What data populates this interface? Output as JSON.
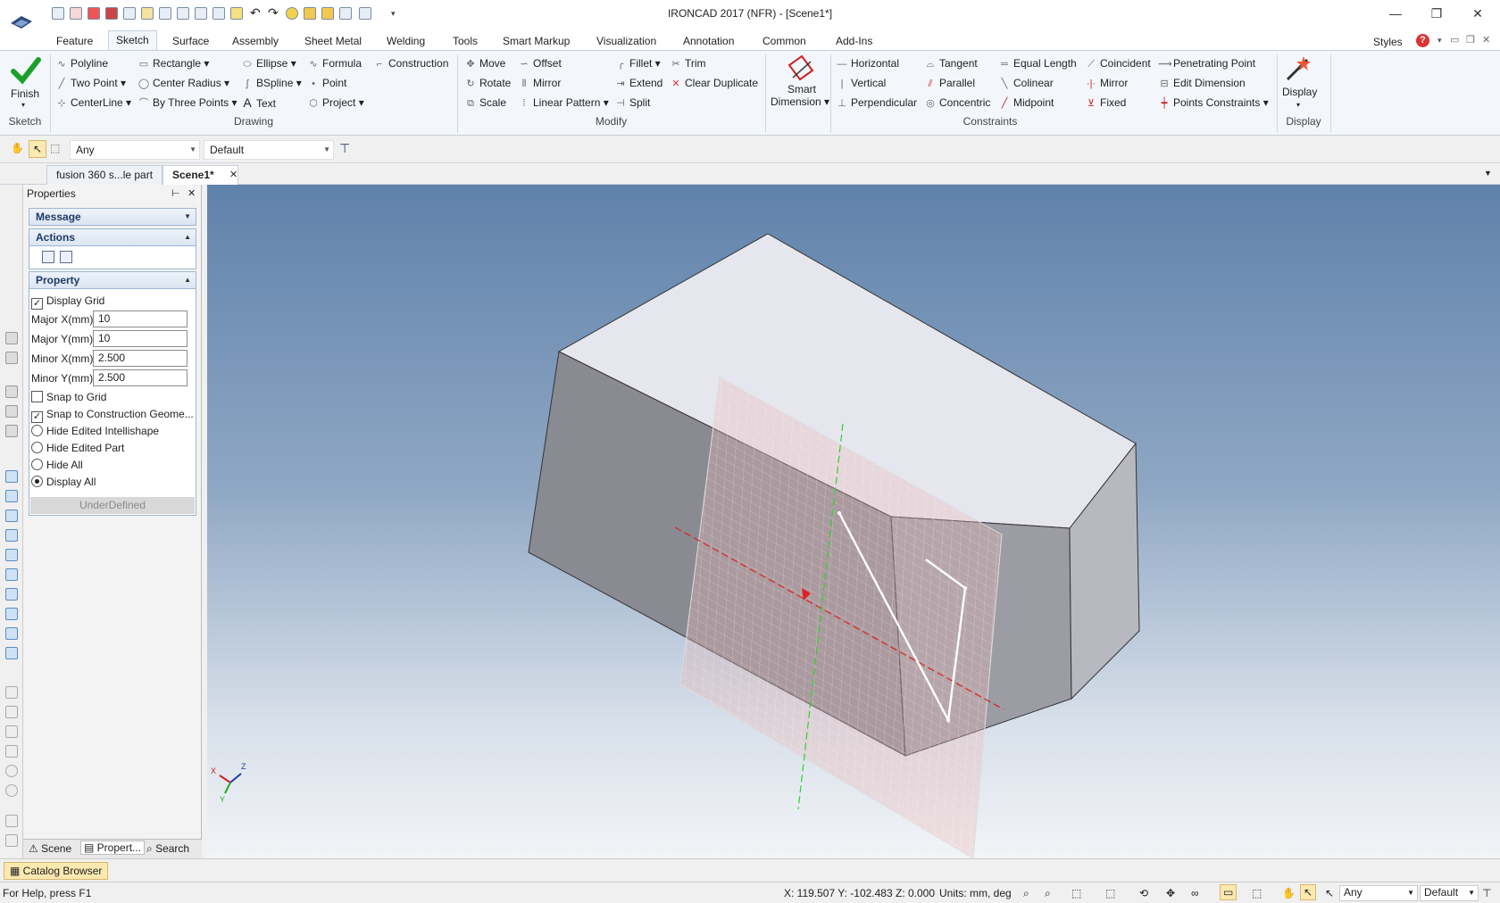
{
  "window": {
    "title": "IRONCAD 2017 (NFR) - [Scene1*]"
  },
  "menu_tabs": [
    "Feature",
    "Sketch",
    "Surface",
    "Assembly",
    "Sheet Metal",
    "Welding",
    "Tools",
    "Smart Markup",
    "Visualization",
    "Annotation",
    "Common",
    "Add-Ins"
  ],
  "active_tab": "Sketch",
  "styles_label": "Styles",
  "ribbon": {
    "finish": {
      "label": "Finish",
      "group": "Sketch"
    },
    "drawing": {
      "group": "Drawing",
      "items": [
        "Polyline",
        "Two Point",
        "CenterLine",
        "Rectangle",
        "Center Radius",
        "By Three Points",
        "Ellipse",
        "BSpline",
        "Text",
        "Formula",
        "Point",
        "Project",
        "Construction"
      ]
    },
    "modify": {
      "group": "Modify",
      "items": [
        "Move",
        "Rotate",
        "Scale",
        "Offset",
        "Mirror",
        "Linear Pattern",
        "Fillet",
        "Extend",
        "Split",
        "Trim",
        "Clear Duplicate"
      ]
    },
    "smart_dimension": {
      "label1": "Smart",
      "label2": "Dimension"
    },
    "constraints": {
      "group": "Constraints",
      "items": [
        "Horizontal",
        "Vertical",
        "Perpendicular",
        "Tangent",
        "Parallel",
        "Concentric",
        "Equal Length",
        "Colinear",
        "Midpoint",
        "Coincident",
        "Mirror",
        "Fixed",
        "Penetrating Point",
        "Edit Dimension",
        "Points Constraints"
      ]
    },
    "display": {
      "label": "Display",
      "group": "Display"
    }
  },
  "filter": {
    "selection": "Any",
    "style": "Default"
  },
  "doc_tabs": [
    {
      "label": "fusion 360 s...le part"
    },
    {
      "label": "Scene1*"
    }
  ],
  "properties": {
    "title": "Properties",
    "sections": {
      "message": "Message",
      "actions": "Actions",
      "property": "Property"
    },
    "display_grid": "Display Grid",
    "fields": [
      {
        "label": "Major X(mm)",
        "value": "10"
      },
      {
        "label": "Major Y(mm)",
        "value": "10"
      },
      {
        "label": "Minor X(mm)",
        "value": "2.500"
      },
      {
        "label": "Minor Y(mm)",
        "value": "2.500"
      }
    ],
    "snap_grid": "Snap to Grid",
    "snap_construction": "Snap to Construction Geome...",
    "radios": [
      "Hide Edited Intellishape",
      "Hide Edited Part",
      "Hide All",
      "Display All"
    ],
    "status": "UnderDefined"
  },
  "bottom_tabs": [
    "Scene",
    "Propert...",
    "Search"
  ],
  "catalog": "Catalog Browser",
  "statusbar": {
    "help": "For Help, press F1",
    "coords": "X: 119.507 Y: -102.483 Z: 0.000",
    "units": "Units: mm, deg",
    "selection": "Any",
    "style": "Default"
  },
  "axes": {
    "x": "X",
    "y": "Y",
    "z": "Z"
  }
}
